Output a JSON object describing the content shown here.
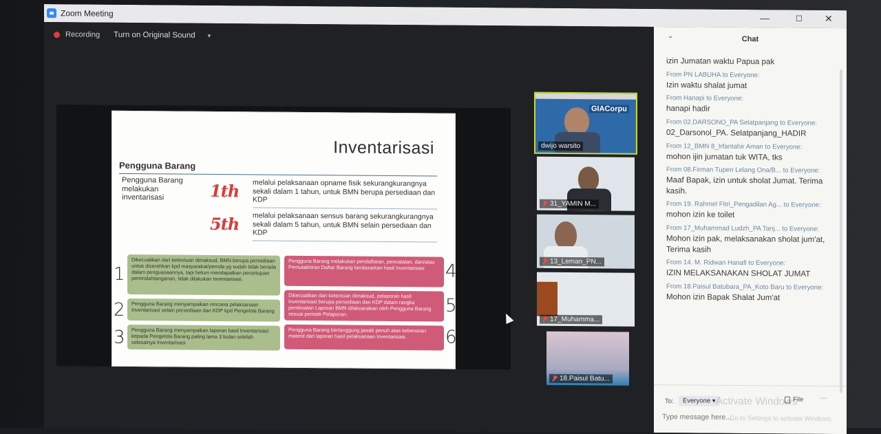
{
  "window": {
    "title": "Zoom Meeting",
    "minimize": "—",
    "maximize": "☐",
    "close": "✕"
  },
  "toolbar": {
    "recording_label": "Recording",
    "sound_label": "Turn on Original Sound",
    "sound_caret": "▾"
  },
  "slide": {
    "title": "Inventarisasi",
    "heading": "Pengguna Barang",
    "subject": "Pengguna Barang melakukan inventarisasi",
    "rows": [
      {
        "freq": "1th",
        "text": "melalui pelaksanaan opname fisik sekurangkurangnya sekali dalam 1 tahun, untuk BMN berupa persediaan dan KDP"
      },
      {
        "freq": "5th",
        "text": "melalui pelaksanaan sensus barang sekurangkurangnya sekali dalam 5 tahun, untuk BMN selain persediaan dan KDP"
      }
    ],
    "boxes": [
      {
        "num": "1",
        "text": "Dikecualikan dari ketentuan dimaksud, BMN berupa persediaan untuk diserahkan kpd masyarakat/pemda yg sudah tidak berada dalam penguasaannya, tapi belum mendapatkan persetujuan pemindahtanganan, tidak dilakukan Inventarisasi."
      },
      {
        "num": "2",
        "text": "Pengguna Barang menyampaikan rencana pelaksanaan Inventarisasi selain persediaan dan KDP kpd Pengelola Barang"
      },
      {
        "num": "3",
        "text": "Pengguna Barang menyampaikan laporan hasil Inventarisasi kepada Pengelola Barang paling lama 3 bulan setelah selesainya Inventarisasi"
      },
      {
        "num": "4",
        "text": "Pengguna Barang melakukan pendaftaran, pencatatan, dan/atau Pemutakhiran Daftar Barang berdasarkan hasil Inventarisasi"
      },
      {
        "num": "5",
        "text": "Dikecualikan dari ketentuan dimaksud, pelaporan hasil Inventarisasi berupa persediaan dan KDP dalam rangka pembuatan Laporan BMN dilaksanakan oleh Pengguna Barang sesuai periode Pelaporan."
      },
      {
        "num": "6",
        "text": "Pengguna Barang bertanggung jawab penuh atas kebenaran materiil dari laporan hasil pelaksanaan Inventarisasi."
      }
    ]
  },
  "participants": [
    {
      "name": "dwijo warsito",
      "muted": false,
      "active": true,
      "logo": "GIACorpu"
    },
    {
      "name": "31_YAMIN M...",
      "muted": true,
      "active": false
    },
    {
      "name": "13_Leman_PN...",
      "muted": true,
      "active": false
    },
    {
      "name": "17_Muhamma...",
      "muted": true,
      "active": false
    },
    {
      "name": "18.Paisul Batu...",
      "muted": true,
      "active": false
    }
  ],
  "chat": {
    "title": "Chat",
    "collapse": "⌄",
    "messages": [
      {
        "from": "",
        "text": "izin Jumatan waktu Papua pak"
      },
      {
        "from": "From PN LABUHA to Everyone:",
        "text": "Izin waktu shalat jumat"
      },
      {
        "from": "From Hanapi to Everyone:",
        "text": "hanapi hadir"
      },
      {
        "from": "From 02.DARSONO_PA Selatpanjang to Everyone:",
        "text": "02_Darsonol_PA. Selatpanjang_HADIR"
      },
      {
        "from": "From 12_BMN 8_Irfantahir Aman to Everyone:",
        "text": "mohon ijin jumatan tuk WITA, tks"
      },
      {
        "from": "From 08.Firman Tupen Lelang Ona/B... to Everyone:",
        "text": "Maaf Bapak, izin untuk sholat Jumat. Terima kasih."
      },
      {
        "from": "From 19. Rahmel Fitri_Pengadilan Ag... to Everyone:",
        "text": "mohon izin ke toilet"
      },
      {
        "from": "From 17_Muhammad Ludzh_PA Tanj... to Everyone:",
        "text": "Mohon izin pak, melaksanakan sholat jum'at, Terima kasih"
      },
      {
        "from": "From 14. M. Ridwan Hanafi to Everyone:",
        "text": "IZIN MELAKSANAKAN SHOLAT JUMAT"
      },
      {
        "from": "From 18.Paisul Batubara_PA_Koto Baru to Everyone:",
        "text": "Mohon izin Bapak Shalat Jum'at"
      }
    ],
    "to_label": "To:",
    "to_value": "Everyone ▾",
    "file_label": "File",
    "more_label": "···",
    "placeholder": "Type message here...",
    "watermark": "Activate Windows",
    "watermark_sub": "Go to Settings to activate Windows."
  }
}
